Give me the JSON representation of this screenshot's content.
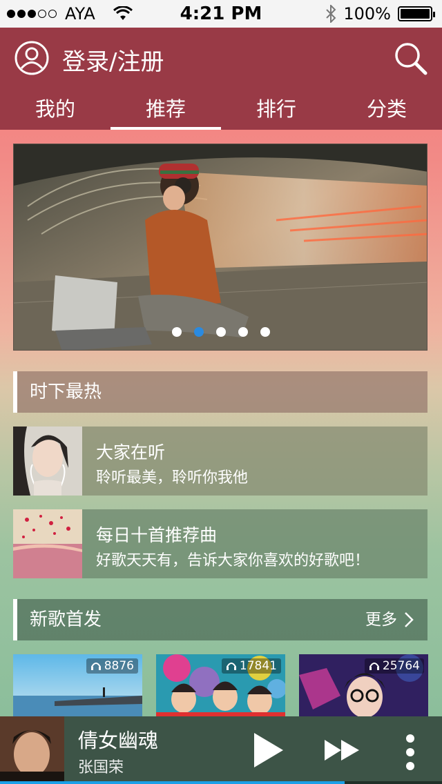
{
  "status_bar": {
    "carrier": "AYA",
    "time": "4:21 PM",
    "battery": "100%"
  },
  "header": {
    "login_label": "登录/注册",
    "tabs": [
      {
        "label": "我的",
        "active": false
      },
      {
        "label": "推荐",
        "active": true
      },
      {
        "label": "排行",
        "active": false
      },
      {
        "label": "分类",
        "active": false
      }
    ]
  },
  "banner": {
    "page_count": 5,
    "active_page": 2
  },
  "hot_section": {
    "title": "时下最热",
    "items": [
      {
        "title": "大家在听",
        "subtitle": "聆听最美，聆听你我他"
      },
      {
        "title": "每日十首推荐曲",
        "subtitle": "好歌天天有，告诉大家你喜欢的好歌吧！"
      }
    ]
  },
  "new_section": {
    "title": "新歌首发",
    "more_label": "更多",
    "albums": [
      {
        "plays": "8876"
      },
      {
        "plays": "17841"
      },
      {
        "plays": "25764"
      }
    ]
  },
  "player": {
    "song": "倩女幽魂",
    "artist": "张国荣",
    "progress": 0.78
  },
  "colors": {
    "header": "#993a46",
    "accent_blue": "#2a8ae0",
    "player_bg": "#3d5447"
  },
  "icons": [
    "user-icon",
    "search-icon",
    "headphones-icon",
    "chevron-right-icon",
    "play-icon",
    "fast-forward-icon",
    "more-vertical-icon",
    "wifi-icon",
    "bluetooth-icon",
    "battery-icon"
  ]
}
